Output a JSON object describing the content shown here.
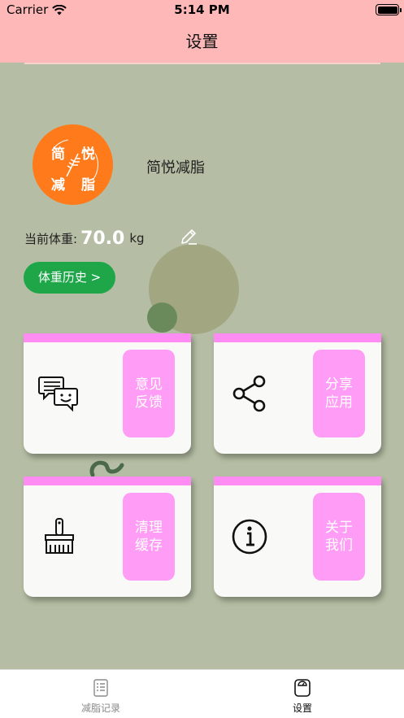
{
  "status_bar": {
    "carrier": "Carrier",
    "time": "5:14 PM"
  },
  "nav": {
    "title": "设置"
  },
  "profile": {
    "logo_chars": [
      "简",
      "悦",
      "减",
      "脂"
    ],
    "app_name": "简悦减脂",
    "weight_label": "当前体重:",
    "weight_value": "70.0",
    "weight_unit": "kg",
    "history_button": "体重历史 >"
  },
  "cards": [
    {
      "label": "意见反馈",
      "icon": "feedback-chat-icon"
    },
    {
      "label": "分享应用",
      "icon": "share-icon"
    },
    {
      "label": "清理缓存",
      "icon": "broom-icon"
    },
    {
      "label": "关于我们",
      "icon": "info-icon"
    }
  ],
  "tabbar": {
    "items": [
      {
        "label": "减脂记录",
        "icon": "list-document-icon",
        "active": false
      },
      {
        "label": "设置",
        "icon": "scale-icon",
        "active": true
      }
    ]
  },
  "colors": {
    "header_bg": "#ffb8b8",
    "page_bg": "#b5bea4",
    "logo_bg": "#ff7a1a",
    "history_button_bg": "#1ea649",
    "card_accent": "#ff9cf5"
  }
}
